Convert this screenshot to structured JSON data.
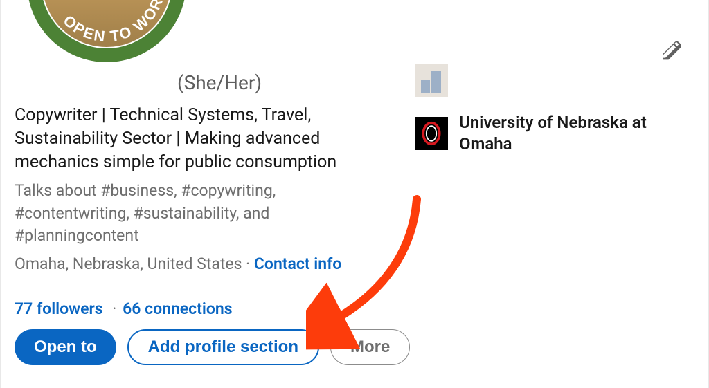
{
  "profile": {
    "open_to_work_ring": "OPEN TO WORK",
    "pronouns": "(She/Her)",
    "headline": "Copywriter | Technical Systems, Travel, Sustainability Sector | Making advanced mechanics simple for public consumption",
    "talks_about": "Talks about #business, #copywriting, #contentwriting, #sustainability, and #planningcontent",
    "location": "Omaha, Nebraska, United States",
    "contact_info": "Contact info",
    "followers": "77 followers",
    "connections": "66 connections"
  },
  "actions": {
    "open_to": "Open to",
    "add_section": "Add profile section",
    "more": "More"
  },
  "organizations": {
    "company": "",
    "school": "University of Nebraska at Omaha"
  }
}
